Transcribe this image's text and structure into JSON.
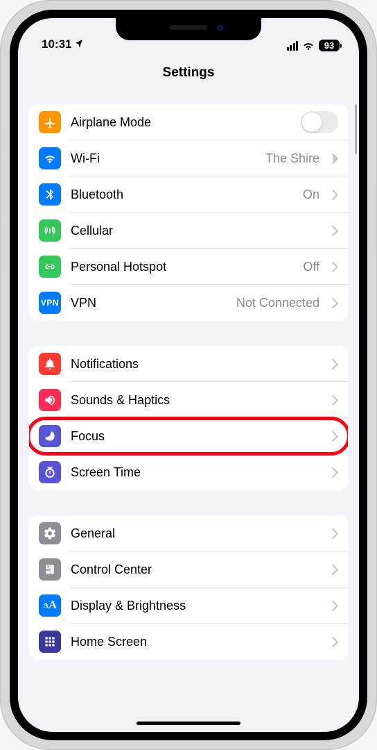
{
  "statusbar": {
    "time": "10:31",
    "battery": "93"
  },
  "header": {
    "title": "Settings"
  },
  "group1": [
    {
      "icon": "airplane",
      "color": "orange",
      "label": "Airplane Mode",
      "control": "toggle",
      "on": false
    },
    {
      "icon": "wifi",
      "color": "blue",
      "label": "Wi-Fi",
      "value": "The Shire",
      "chevron": true
    },
    {
      "icon": "bluetooth",
      "color": "blue",
      "label": "Bluetooth",
      "value": "On",
      "chevron": true
    },
    {
      "icon": "cellular",
      "color": "green",
      "label": "Cellular",
      "chevron": true
    },
    {
      "icon": "hotspot",
      "color": "green",
      "label": "Personal Hotspot",
      "value": "Off",
      "chevron": true
    },
    {
      "icon": "vpn",
      "color": "blue",
      "label": "VPN",
      "value": "Not Connected",
      "chevron": true
    }
  ],
  "group2": [
    {
      "icon": "notifications",
      "color": "red",
      "label": "Notifications",
      "chevron": true
    },
    {
      "icon": "sounds",
      "color": "red",
      "label": "Sounds & Haptics",
      "chevron": true
    },
    {
      "icon": "focus",
      "color": "purple",
      "label": "Focus",
      "chevron": true,
      "highlight": true
    },
    {
      "icon": "screentime",
      "color": "purple",
      "label": "Screen Time",
      "chevron": true
    }
  ],
  "group3": [
    {
      "icon": "general",
      "color": "gray",
      "label": "General",
      "chevron": true
    },
    {
      "icon": "controlcenter",
      "color": "gray",
      "label": "Control Center",
      "chevron": true
    },
    {
      "icon": "display",
      "color": "blue",
      "label": "Display & Brightness",
      "chevron": true
    },
    {
      "icon": "homescreen",
      "color": "bluefill",
      "label": "Home Screen",
      "chevron": true
    }
  ]
}
